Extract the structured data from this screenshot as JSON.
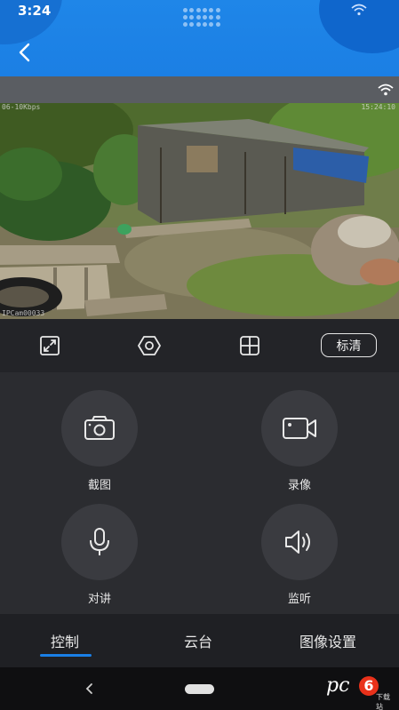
{
  "status_bar": {
    "time": "3:24"
  },
  "video": {
    "overlay_top": "06-10Kbps",
    "overlay_right": "15:24:10",
    "overlay_bottom": "IPCam00033"
  },
  "toolbar": {
    "quality_label": "标清",
    "icons": [
      "fullscreen-icon",
      "eye-icon",
      "grid-icon"
    ]
  },
  "controls": [
    {
      "label": "截图",
      "icon": "camera-icon"
    },
    {
      "label": "录像",
      "icon": "video-record-icon"
    },
    {
      "label": "对讲",
      "icon": "microphone-icon"
    },
    {
      "label": "监听",
      "icon": "speaker-icon"
    }
  ],
  "tabs": [
    {
      "label": "控制",
      "active": true
    },
    {
      "label": "云台",
      "active": false
    },
    {
      "label": "图像设置",
      "active": false
    }
  ],
  "watermark": {
    "text": "pc",
    "number": "6",
    "sub": "下载站"
  },
  "colors": {
    "header_blue": "#1f86e8",
    "accent": "#1a7fe6",
    "panel": "#2b2c30"
  }
}
